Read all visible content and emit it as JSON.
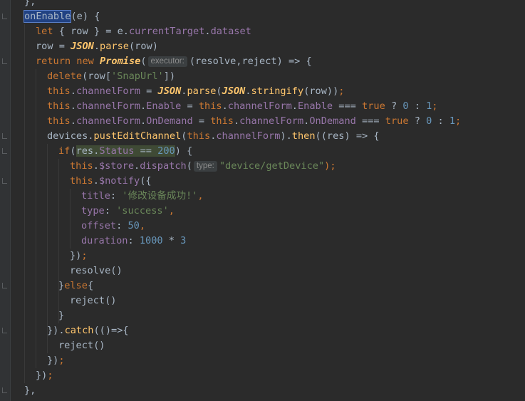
{
  "editor": {
    "lines": [
      [
        {
          "t": "},",
          "c": "plain"
        }
      ],
      [
        {
          "t": "onEnable",
          "c": "plain",
          "box": "sel"
        },
        {
          "t": "(e) {",
          "c": "plain"
        }
      ],
      [
        {
          "t": "let ",
          "c": "kw"
        },
        {
          "t": "{ row } = e.",
          "c": "plain"
        },
        {
          "t": "currentTarget",
          "c": "prop"
        },
        {
          "t": ".",
          "c": "plain"
        },
        {
          "t": "dataset",
          "c": "prop"
        }
      ],
      [
        {
          "t": "row = ",
          "c": "plain"
        },
        {
          "t": "JSON",
          "c": "cls"
        },
        {
          "t": ".",
          "c": "plain"
        },
        {
          "t": "parse",
          "c": "fn"
        },
        {
          "t": "(row)",
          "c": "plain"
        }
      ],
      [
        {
          "t": "return new ",
          "c": "kw"
        },
        {
          "t": "Promise",
          "c": "cls"
        },
        {
          "t": "(",
          "c": "plain"
        },
        {
          "hint": "executor:"
        },
        {
          "t": "(resolve,reject) => {",
          "c": "plain"
        }
      ],
      [
        {
          "t": "delete",
          "c": "kw"
        },
        {
          "t": "(row[",
          "c": "plain"
        },
        {
          "t": "'SnapUrl'",
          "c": "str"
        },
        {
          "t": "])",
          "c": "plain"
        }
      ],
      [
        {
          "t": "this",
          "c": "kw"
        },
        {
          "t": ".",
          "c": "plain"
        },
        {
          "t": "channelForm",
          "c": "prop"
        },
        {
          "t": " = ",
          "c": "plain"
        },
        {
          "t": "JSON",
          "c": "cls"
        },
        {
          "t": ".",
          "c": "plain"
        },
        {
          "t": "parse",
          "c": "fn"
        },
        {
          "t": "(",
          "c": "plain"
        },
        {
          "t": "JSON",
          "c": "cls"
        },
        {
          "t": ".",
          "c": "plain"
        },
        {
          "t": "stringify",
          "c": "fn"
        },
        {
          "t": "(row))",
          "c": "plain"
        },
        {
          "t": ";",
          "c": "kw"
        }
      ],
      [
        {
          "t": "this",
          "c": "kw"
        },
        {
          "t": ".",
          "c": "plain"
        },
        {
          "t": "channelForm",
          "c": "prop"
        },
        {
          "t": ".",
          "c": "plain"
        },
        {
          "t": "Enable",
          "c": "prop"
        },
        {
          "t": " = ",
          "c": "plain"
        },
        {
          "t": "this",
          "c": "kw"
        },
        {
          "t": ".",
          "c": "plain"
        },
        {
          "t": "channelForm",
          "c": "prop"
        },
        {
          "t": ".",
          "c": "plain"
        },
        {
          "t": "Enable",
          "c": "prop"
        },
        {
          "t": " === ",
          "c": "plain"
        },
        {
          "t": "true",
          "c": "kw"
        },
        {
          "t": " ? ",
          "c": "plain"
        },
        {
          "t": "0",
          "c": "num"
        },
        {
          "t": " : ",
          "c": "plain"
        },
        {
          "t": "1",
          "c": "num"
        },
        {
          "t": ";",
          "c": "kw"
        }
      ],
      [
        {
          "t": "this",
          "c": "kw"
        },
        {
          "t": ".",
          "c": "plain"
        },
        {
          "t": "channelForm",
          "c": "prop"
        },
        {
          "t": ".",
          "c": "plain"
        },
        {
          "t": "OnDemand",
          "c": "prop"
        },
        {
          "t": " = ",
          "c": "plain"
        },
        {
          "t": "this",
          "c": "kw"
        },
        {
          "t": ".",
          "c": "plain"
        },
        {
          "t": "channelForm",
          "c": "prop"
        },
        {
          "t": ".",
          "c": "plain"
        },
        {
          "t": "OnDemand",
          "c": "prop"
        },
        {
          "t": " === ",
          "c": "plain"
        },
        {
          "t": "true",
          "c": "kw"
        },
        {
          "t": " ? ",
          "c": "plain"
        },
        {
          "t": "0",
          "c": "num"
        },
        {
          "t": " : ",
          "c": "plain"
        },
        {
          "t": "1",
          "c": "num"
        },
        {
          "t": ";",
          "c": "kw"
        }
      ],
      [
        {
          "t": "devices.",
          "c": "plain"
        },
        {
          "t": "pustEditChannel",
          "c": "fn"
        },
        {
          "t": "(",
          "c": "plain"
        },
        {
          "t": "this",
          "c": "kw"
        },
        {
          "t": ".",
          "c": "plain"
        },
        {
          "t": "channelForm",
          "c": "prop"
        },
        {
          "t": ").",
          "c": "plain"
        },
        {
          "t": "then",
          "c": "fn"
        },
        {
          "t": "((res) => {",
          "c": "plain"
        }
      ],
      [
        {
          "t": "if",
          "c": "kw"
        },
        {
          "t": "(",
          "c": "plain"
        },
        {
          "t": "res.",
          "c": "plain",
          "box": "hl"
        },
        {
          "t": "Status",
          "c": "prop",
          "box": "hl"
        },
        {
          "t": " == ",
          "c": "plain",
          "box": "hl"
        },
        {
          "t": "200",
          "c": "num",
          "box": "hl"
        },
        {
          "t": ") {",
          "c": "plain"
        }
      ],
      [
        {
          "t": "this",
          "c": "kw"
        },
        {
          "t": ".",
          "c": "plain"
        },
        {
          "t": "$store",
          "c": "prop"
        },
        {
          "t": ".",
          "c": "plain"
        },
        {
          "t": "dispatch",
          "c": "prop"
        },
        {
          "t": "(",
          "c": "plain"
        },
        {
          "hint": "type:"
        },
        {
          "t": "\"device/getDevice\"",
          "c": "str"
        },
        {
          "t": ");",
          "c": "kw"
        }
      ],
      [
        {
          "t": "this",
          "c": "kw"
        },
        {
          "t": ".",
          "c": "plain"
        },
        {
          "t": "$notify",
          "c": "prop"
        },
        {
          "t": "({",
          "c": "plain"
        }
      ],
      [
        {
          "t": "title",
          "c": "prop"
        },
        {
          "t": ": ",
          "c": "plain"
        },
        {
          "t": "'修改设备成功!'",
          "c": "str"
        },
        {
          "t": ",",
          "c": "kw"
        }
      ],
      [
        {
          "t": "type",
          "c": "prop"
        },
        {
          "t": ": ",
          "c": "plain"
        },
        {
          "t": "'success'",
          "c": "str"
        },
        {
          "t": ",",
          "c": "kw"
        }
      ],
      [
        {
          "t": "offset",
          "c": "prop"
        },
        {
          "t": ": ",
          "c": "plain"
        },
        {
          "t": "50",
          "c": "num"
        },
        {
          "t": ",",
          "c": "kw"
        }
      ],
      [
        {
          "t": "duration",
          "c": "prop"
        },
        {
          "t": ": ",
          "c": "plain"
        },
        {
          "t": "1000",
          "c": "num"
        },
        {
          "t": " * ",
          "c": "plain"
        },
        {
          "t": "3",
          "c": "num"
        }
      ],
      [
        {
          "t": "})",
          "c": "plain"
        },
        {
          "t": ";",
          "c": "kw"
        }
      ],
      [
        {
          "t": "resolve()",
          "c": "plain"
        }
      ],
      [
        {
          "t": "}",
          "c": "plain"
        },
        {
          "t": "else",
          "c": "kw"
        },
        {
          "t": "{",
          "c": "plain"
        }
      ],
      [
        {
          "t": "reject()",
          "c": "plain"
        }
      ],
      [
        {
          "t": "}",
          "c": "plain"
        }
      ],
      [
        {
          "t": "}).",
          "c": "plain"
        },
        {
          "t": "catch",
          "c": "fn"
        },
        {
          "t": "(()=>{",
          "c": "plain"
        }
      ],
      [
        {
          "t": "reject()",
          "c": "plain"
        }
      ],
      [
        {
          "t": "})",
          "c": "plain"
        },
        {
          "t": ";",
          "c": "kw"
        }
      ],
      [
        {
          "t": "})",
          "c": "plain"
        },
        {
          "t": ";",
          "c": "kw"
        }
      ],
      [
        {
          "t": "},",
          "c": "plain"
        }
      ]
    ]
  }
}
